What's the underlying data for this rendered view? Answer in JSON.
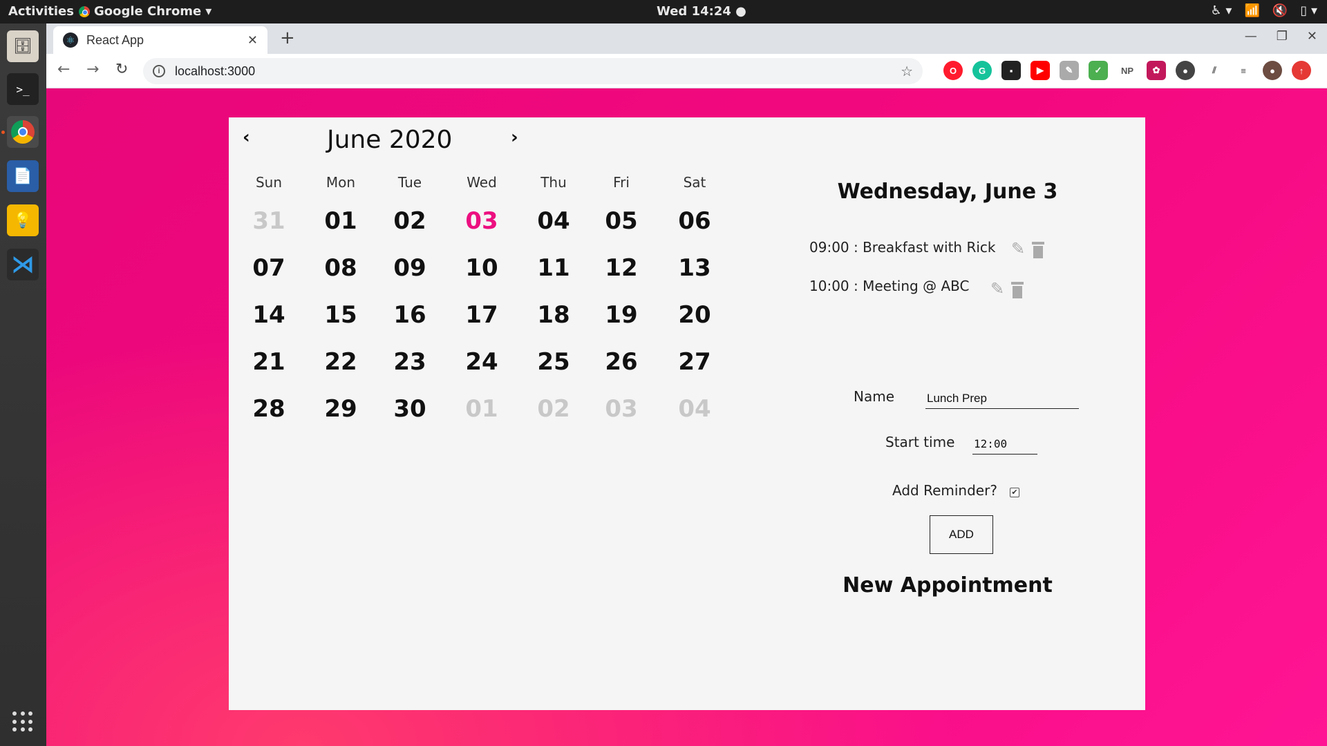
{
  "topbar": {
    "activities": "Activities",
    "app_name": "Google Chrome",
    "clock": "Wed 14:24"
  },
  "browser": {
    "tab_title": "React App",
    "url": "localhost:3000",
    "extensions": [
      "opera-icon",
      "grammarly-icon",
      "ext-dark-icon",
      "youtube-icon",
      "ext-grey-icon",
      "ext-green-icon",
      "NP",
      "ext-red-icon",
      "ext-circle-icon",
      "ext-slash-icon",
      "media-icon",
      "profile-avatar",
      "update-icon"
    ]
  },
  "calendar": {
    "month_label": "June 2020",
    "weekdays": [
      "Sun",
      "Mon",
      "Tue",
      "Wed",
      "Thu",
      "Fri",
      "Sat"
    ],
    "weeks": [
      [
        "31",
        "01",
        "02",
        "03",
        "04",
        "05",
        "06"
      ],
      [
        "07",
        "08",
        "09",
        "10",
        "11",
        "12",
        "13"
      ],
      [
        "14",
        "15",
        "16",
        "17",
        "18",
        "19",
        "20"
      ],
      [
        "21",
        "22",
        "23",
        "24",
        "25",
        "26",
        "27"
      ],
      [
        "28",
        "29",
        "30",
        "01",
        "02",
        "03",
        "04"
      ]
    ],
    "selected_day": "03",
    "outside_month_days": {
      "first_week_leading": 1,
      "last_week_trailing": 4
    },
    "colors": {
      "selected": "#ec0f80",
      "muted": "#c8c8c8",
      "background": "#f4087f"
    }
  },
  "side_panel": {
    "day_heading": "Wednesday, June 3",
    "appointments": [
      {
        "text": "09:00 : Breakfast with Rick"
      },
      {
        "text": "10:00 : Meeting @ ABC"
      }
    ],
    "form": {
      "name_label": "Name",
      "name_value": "Lunch Prep",
      "start_label": "Start time",
      "start_value": "12:00",
      "reminder_label": "Add Reminder?",
      "reminder_checked": true,
      "add_label": "ADD"
    },
    "new_heading": "New Appointment"
  }
}
